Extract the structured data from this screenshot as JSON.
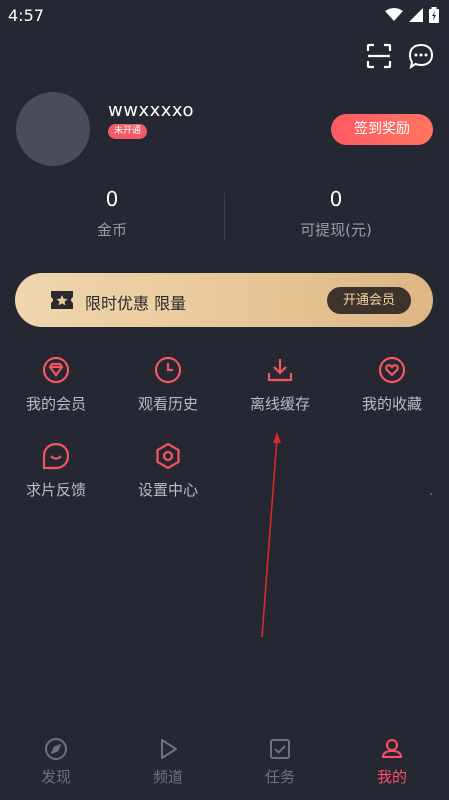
{
  "status_bar": {
    "time": "4:57"
  },
  "profile": {
    "username": "wwxxxxo",
    "vip_badge": "未开通",
    "checkin_label": "签到奖励"
  },
  "stats": {
    "coins": {
      "value": "0",
      "label": "金币"
    },
    "withdrawable": {
      "value": "0",
      "label": "可提现(元)"
    }
  },
  "vip_banner": {
    "promo_text": "限时优惠 限量",
    "open_label": "开通会员"
  },
  "menu": {
    "items": [
      {
        "label": "我的会员",
        "icon": "diamond-icon"
      },
      {
        "label": "观看历史",
        "icon": "clock-icon"
      },
      {
        "label": "离线缓存",
        "icon": "download-icon"
      },
      {
        "label": "我的收藏",
        "icon": "heart-icon"
      },
      {
        "label": "求片反馈",
        "icon": "chat-smile-icon"
      },
      {
        "label": "设置中心",
        "icon": "settings-hexagon-icon"
      }
    ]
  },
  "bottom_nav": {
    "items": [
      {
        "label": "发现",
        "icon": "compass-icon"
      },
      {
        "label": "频道",
        "icon": "play-icon"
      },
      {
        "label": "任务",
        "icon": "task-check-icon"
      },
      {
        "label": "我的",
        "icon": "profile-icon"
      }
    ],
    "active": "我的"
  },
  "colors": {
    "background": "#252733",
    "accent": "#ff4f68",
    "gold": "#e9c99a"
  }
}
